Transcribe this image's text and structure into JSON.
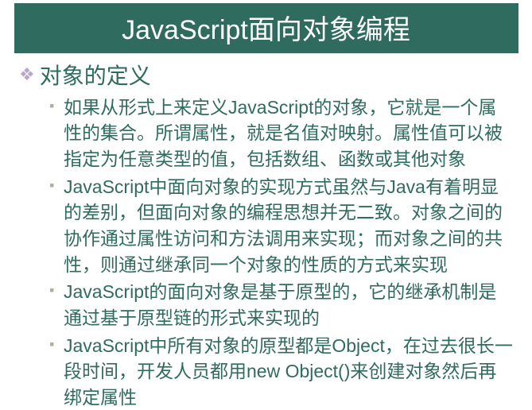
{
  "title": "JavaScript面向对象编程",
  "heading": "对象的定义",
  "bullets": [
    "如果从形式上来定义JavaScript的对象，它就是一个属性的集合。所谓属性，就是名值对映射。属性值可以被指定为任意类型的值，包括数组、函数或其他对象",
    "JavaScript中面向对象的实现方式虽然与Java有着明显的差别，但面向对象的编程思想并无二致。对象之间的协作通过属性访问和方法调用来实现；而对象之间的共性，则通过继承同一个对象的性质的方式来实现",
    "JavaScript的面向对象是基于原型的，它的继承机制是通过基于原型链的形式来实现的",
    "JavaScript中所有对象的原型都是Object，在过去很长一段时间，开发人员都用new Object()来创建对象然后再绑定属性"
  ]
}
